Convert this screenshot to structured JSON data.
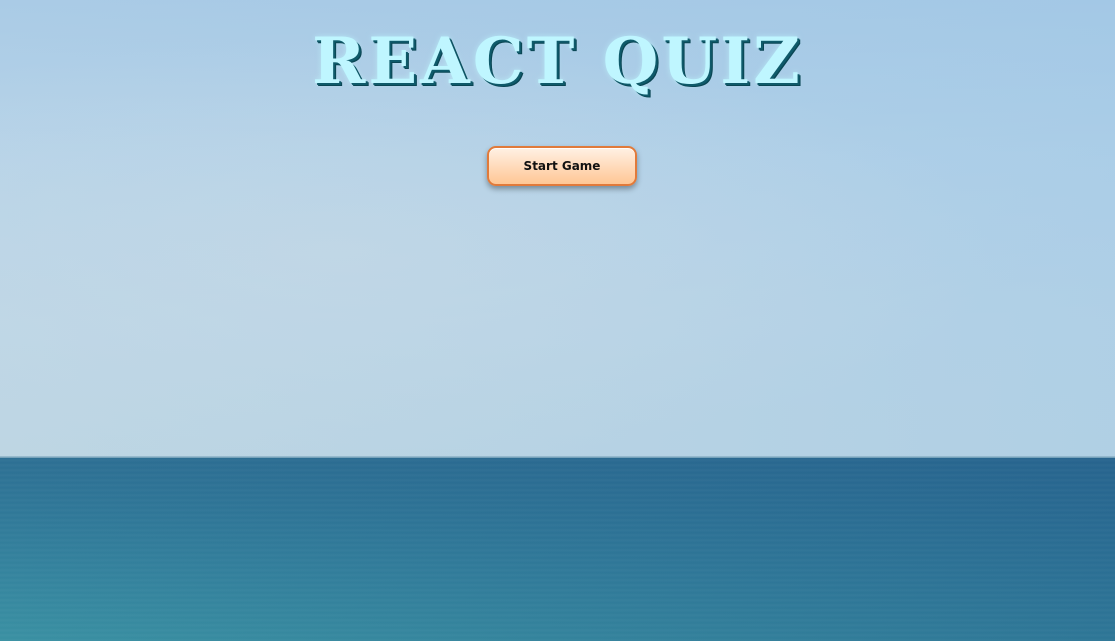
{
  "app": {
    "title": "REACT QUIZ"
  },
  "controls": {
    "start_label": "Start Game"
  },
  "colors": {
    "title_fill": "#bff6ff",
    "title_outline": "#0f5a6a",
    "button_border": "#e17a3a",
    "button_fill": "#ffd9b8",
    "sky": "#b6d3e8",
    "sea": "#2f7898"
  }
}
